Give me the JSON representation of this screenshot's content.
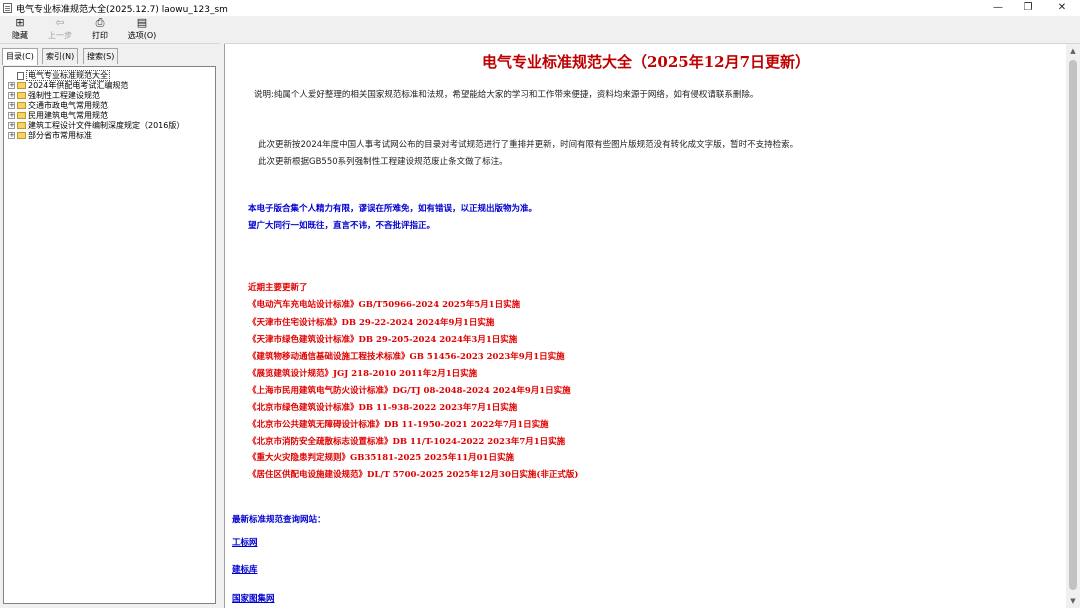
{
  "window": {
    "title": "电气专业标准规范大全(2025.12.7) laowu_123_sm",
    "minimize_glyph": "—",
    "restore_glyph": "❐",
    "close_glyph": "✕"
  },
  "toolbar": {
    "hide": {
      "label": "隐藏",
      "icon": "hide-icon",
      "glyph": "⊞"
    },
    "back": {
      "label": "上一步",
      "icon": "back-arrow-icon",
      "glyph": "⇦"
    },
    "print": {
      "label": "打印",
      "icon": "printer-icon",
      "glyph": "⎙"
    },
    "options": {
      "label": "选项(O)",
      "icon": "options-icon",
      "glyph": "▤"
    }
  },
  "tabs": [
    "目录(C)",
    "索引(N)",
    "搜索(S)"
  ],
  "tree": [
    {
      "label": "电气专业标准规范大全",
      "type": "doc",
      "selected": true
    },
    {
      "label": "2024年供配电考试汇编规范",
      "type": "folder"
    },
    {
      "label": "强制性工程建设规范",
      "type": "folder"
    },
    {
      "label": "交通市政电气常用规范",
      "type": "folder"
    },
    {
      "label": "民用建筑电气常用规范",
      "type": "folder"
    },
    {
      "label": "建筑工程设计文件编制深度规定（2016版）",
      "type": "folder"
    },
    {
      "label": "部分省市常用标准",
      "type": "folder"
    }
  ],
  "content": {
    "title": "电气专业标准规范大全（2025年12月7日更新）",
    "note": "说明:纯属个人爱好整理的相关国家规范标准和法规，希望能给大家的学习和工作带来便捷，资料均来源于网络，如有侵权请联系删除。",
    "update_1": "此次更新按2024年度中国人事考试网公布的目录对考试规范进行了重排并更新，时间有限有些图片版规范没有转化成文字版，暂时不支持检索。",
    "update_2": "此次更新根据GB550系列强制性工程建设规范废止条文做了标注。",
    "disclaimer_1": "本电子版合集个人精力有限，谬误在所难免，如有错误，以正规出版物为准。",
    "disclaimer_2": "望广大同行一如既往，直言不讳，不吝批评指正。",
    "recent_heading": "近期主要更新了",
    "recent": [
      "《电动汽车充电站设计标准》GB/T50966-2024 2025年5月1日实施",
      "《天津市住宅设计标准》DB 29-22-2024 2024年9月1日实施",
      "《天津市绿色建筑设计标准》DB 29-205-2024 2024年3月1日实施",
      "《建筑物移动通信基础设施工程技术标准》GB 51456-2023 2023年9月1日实施",
      "《展览建筑设计规范》JGJ 218-2010 2011年2月1日实施",
      "《上海市民用建筑电气防火设计标准》DG/TJ 08-2048-2024 2024年9月1日实施",
      "《北京市绿色建筑设计标准》DB 11-938-2022 2023年7月1日实施",
      "《北京市公共建筑无障碍设计标准》DB 11-1950-2021 2022年7月1日实施",
      "《北京市消防安全疏散标志设置标准》DB 11/T-1024-2022 2023年7月1日实施",
      "《重大火灾隐患判定规则》GB35181-2025 2025年11月01日实施",
      "《居住区供配电设施建设规范》DL/T 5700-2025 2025年12月30日实施(非正式版)"
    ],
    "sites_heading": "最新标准规范查询网站：",
    "links": [
      "工标网",
      "建标库",
      "国家图集网"
    ]
  }
}
